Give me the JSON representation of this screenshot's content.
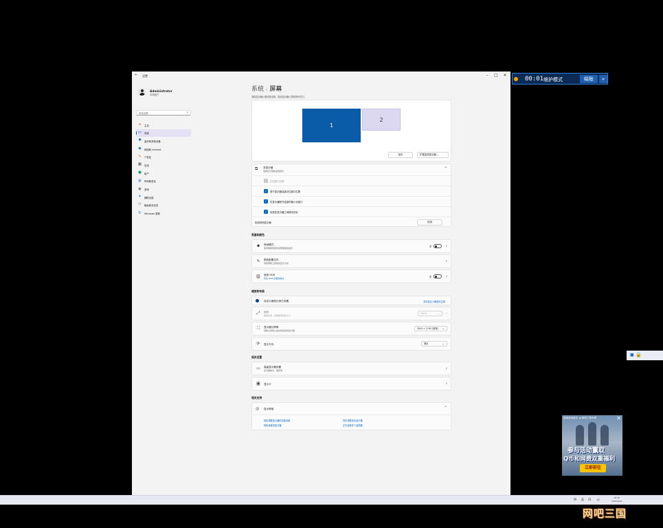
{
  "window": {
    "title": "设置",
    "back_glyph": "←",
    "controls": {
      "minimize": "–",
      "maximize": "□",
      "close": "✕"
    }
  },
  "sidebar": {
    "user_name": "Administrator",
    "user_subtitle": "本地帐户",
    "search_placeholder": "查找设置",
    "items": [
      {
        "label": "主页",
        "icon": "home-icon",
        "glyph": "⌂",
        "color": "#d84d3e"
      },
      {
        "label": "系统",
        "icon": "monitor-icon",
        "glyph": "▭",
        "color": "#0067c0"
      },
      {
        "label": "蓝牙和其他设备",
        "icon": "bluetooth-icon",
        "glyph": "✱",
        "color": "#0067c0"
      },
      {
        "label": "网络和 Internet",
        "icon": "wifi-icon",
        "glyph": "◆",
        "color": "#1f6fc9"
      },
      {
        "label": "个性化",
        "icon": "brush-icon",
        "glyph": "✎",
        "color": "#d87a22"
      },
      {
        "label": "应用",
        "icon": "apps-icon",
        "glyph": "▦",
        "color": "#555555"
      },
      {
        "label": "帐户",
        "icon": "person-icon",
        "glyph": "●",
        "color": "#1a9a6a"
      },
      {
        "label": "时间和语言",
        "icon": "globe-clock-icon",
        "glyph": "◍",
        "color": "#1f6fc9"
      },
      {
        "label": "游戏",
        "icon": "gamepad-icon",
        "glyph": "◉",
        "color": "#6a6a6a"
      },
      {
        "label": "辅助功能",
        "icon": "accessibility-icon",
        "glyph": "✦",
        "color": "#1f6fc9"
      },
      {
        "label": "隐私和安全性",
        "icon": "shield-icon",
        "glyph": "⛉",
        "color": "#666666"
      },
      {
        "label": "Windows 更新",
        "icon": "update-icon",
        "glyph": "↻",
        "color": "#1f6fc9"
      }
    ],
    "selected_index": 1
  },
  "main": {
    "breadcrumb_parent": "系统",
    "breadcrumb_sep": "›",
    "breadcrumb_current": "屏幕",
    "arrange_desc": "选择显示器以更改其设置。拖动显示器以重新排列它们。",
    "monitors": [
      "1",
      "2"
    ],
    "identify_btn": "标识",
    "extend_dropdown": "扩展这些显示器",
    "multi": {
      "title": "多显示器",
      "subtitle": "选择显示器的呈现模式",
      "options": [
        {
          "label": "记住窗口位置",
          "checked": true,
          "disabled": true
        },
        {
          "label": "基于显示器连接记住窗口位置",
          "checked": true,
          "disabled": false
        },
        {
          "label": "在显示器断开连接时最小化窗口",
          "checked": true,
          "disabled": false
        },
        {
          "label": "轻松在显示器之间移动光标",
          "checked": true,
          "disabled": false
        }
      ],
      "detect_label": "检测其他显示器",
      "detect_btn": "检测"
    },
    "brightness_header": "亮度和颜色",
    "night_light": {
      "title": "夜间模式",
      "subtitle": "使用较暖的颜色来帮助阻挡蓝光",
      "state": "关"
    },
    "color_profile": {
      "title": "颜色配置文件",
      "subtitle": "调整屏幕上颜色的显示方式"
    },
    "hdr": {
      "title": "使用 HDR",
      "subtitle": "有关 HDR 的更多信息",
      "state": "关"
    },
    "scale_header": "缩放和布局",
    "custom_scale_note": "自定义缩放比例已设置。",
    "custom_scale_link": "关闭自定义缩放并注销",
    "scale": {
      "title": "缩放",
      "subtitle": "更改文本、应用等项目的大小",
      "value": "200%"
    },
    "resolution": {
      "title": "显示器分辨率",
      "subtitle": "调整分辨率以适合所连接的显示器",
      "value": "3840 × 2160 (推荐)"
    },
    "orientation": {
      "title": "显示方向",
      "value": "横向"
    },
    "related_header": "相关设置",
    "advanced": {
      "title": "高级显示器设置",
      "subtitle": "显示器信息、刷新率"
    },
    "graphics": {
      "title": "显示卡"
    },
    "support_header": "相关支持",
    "help": {
      "title": "显示帮助"
    },
    "help_links": [
      "轻松调整显示器的亮度设置",
      "同步调整多台显示器",
      "轻松设置双显示器",
      "正在设置多个监视器"
    ]
  },
  "overlay_timer": {
    "time": "00:01",
    "text": "维护模式",
    "end_button": "结账",
    "extra_button": "»"
  },
  "taskbar": {
    "tray": [
      "✉",
      "英",
      "⊡",
      "◁)"
    ],
    "clock_time": "16:35",
    "clock_date": "2025/4/23"
  },
  "side_widget": {
    "text": "◼ 🔒"
  },
  "ad": {
    "top_text": "搜索游戏助手  ◈ 网吧三国专享",
    "line1": "参与活动赢取",
    "line2": "Q币和网费双重福利",
    "button": "立即前往",
    "close": "✕"
  },
  "brand": "网吧三国"
}
